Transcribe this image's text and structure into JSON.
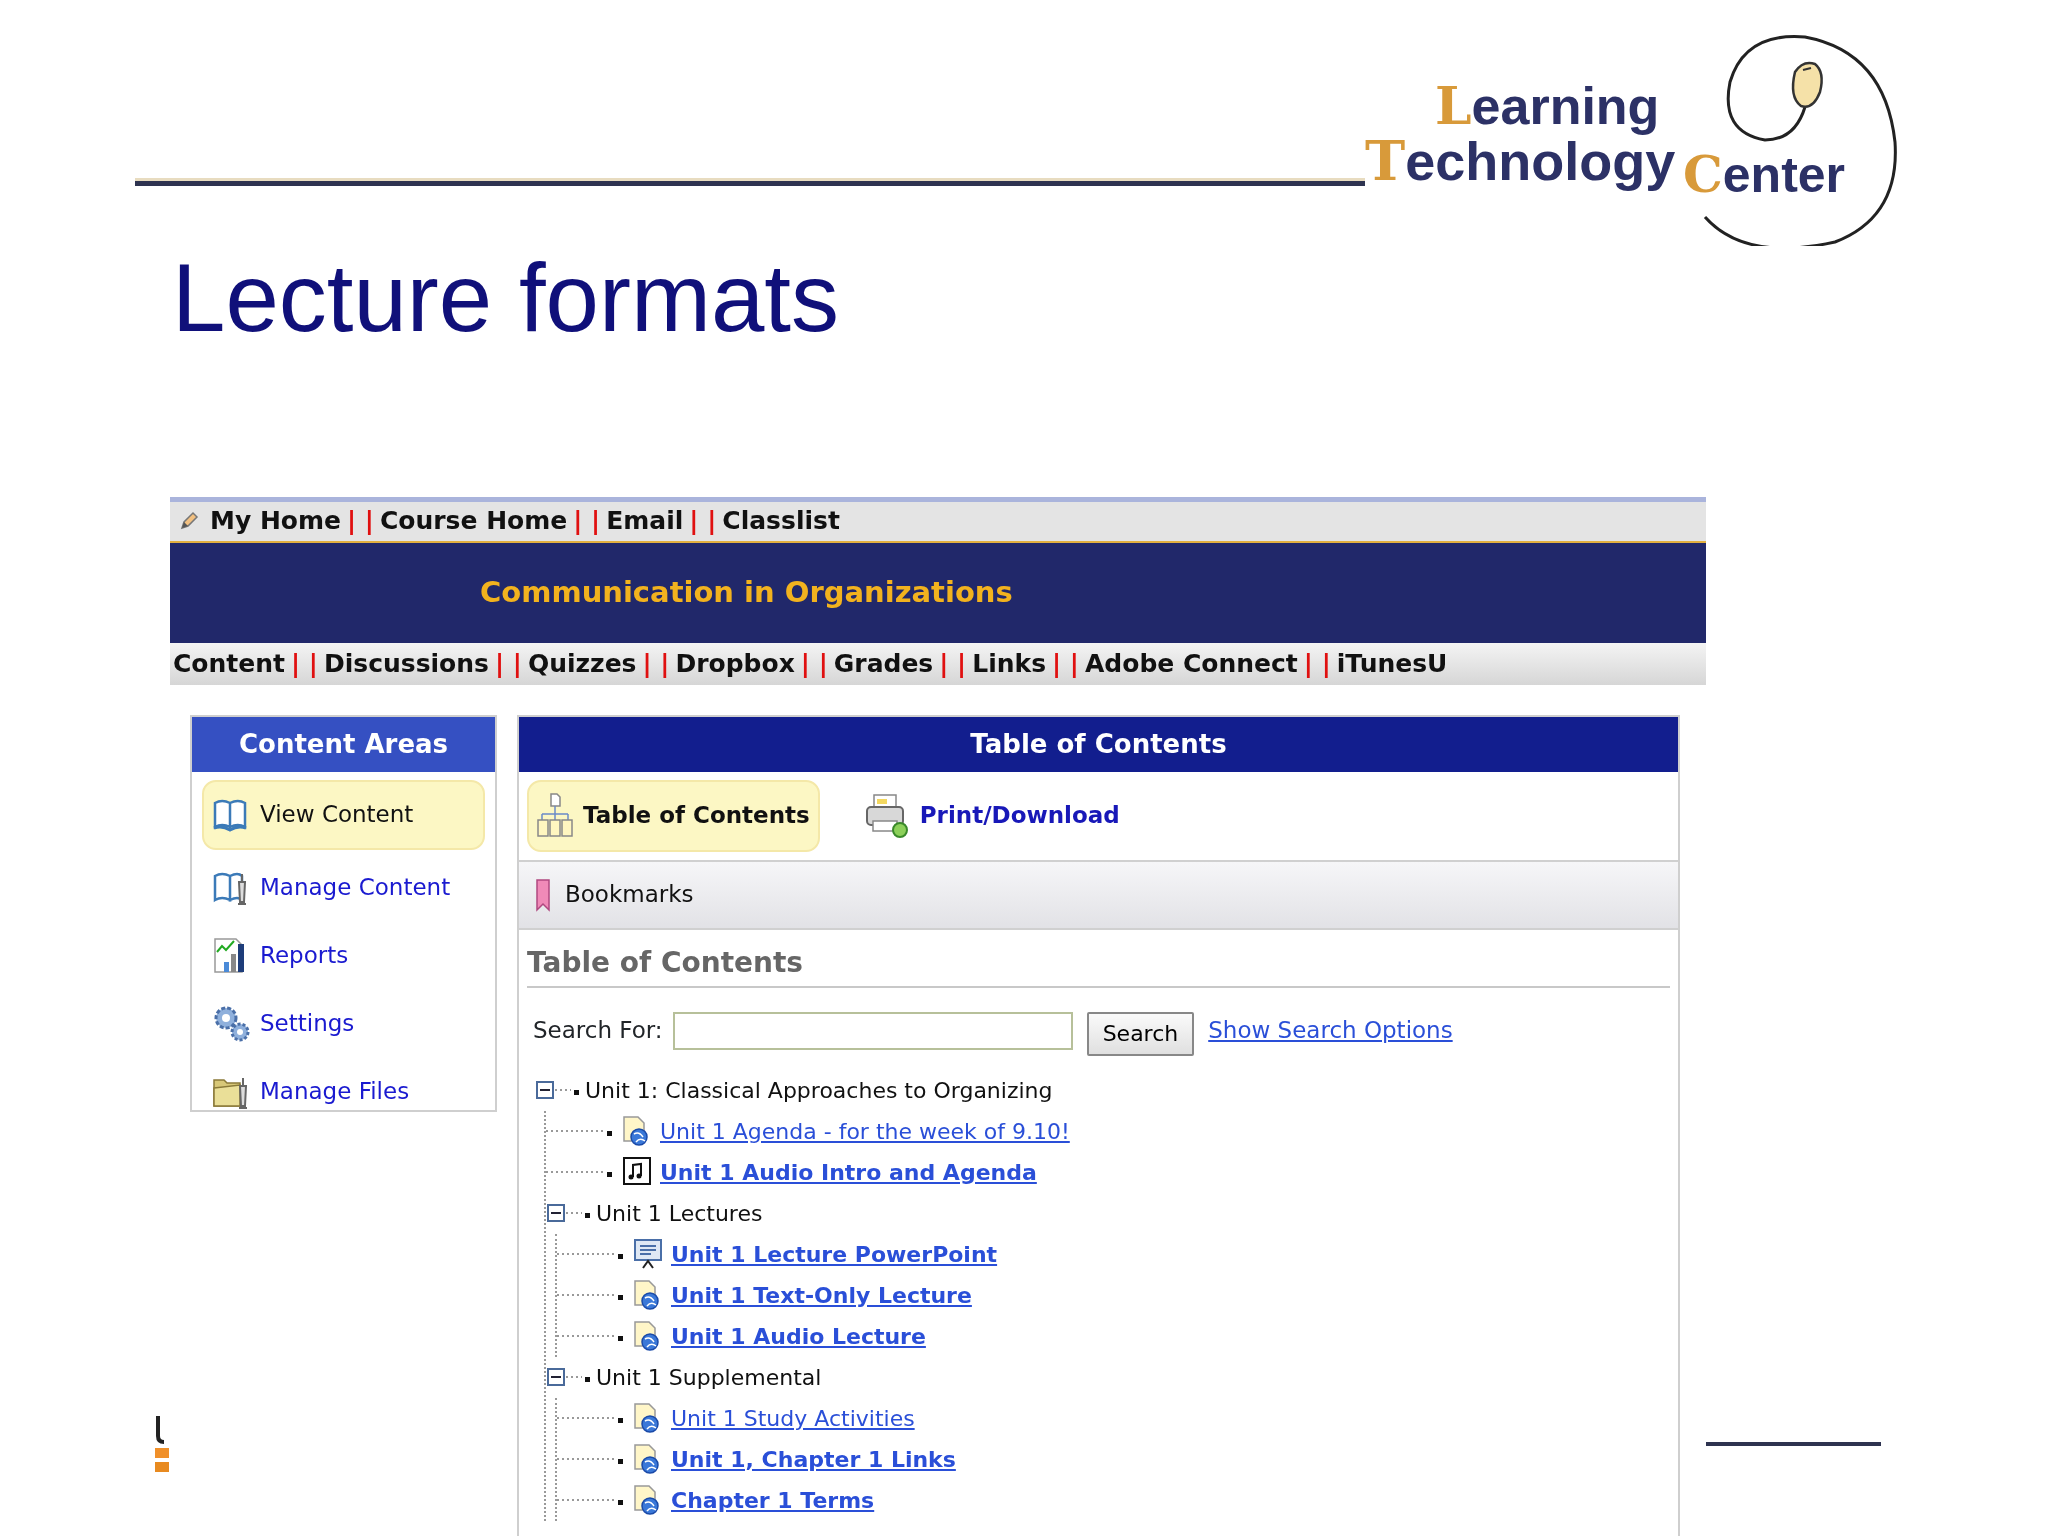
{
  "slide": {
    "title": "Lecture formats",
    "logo": {
      "words": [
        "Learning",
        "Technology",
        "Center"
      ]
    }
  },
  "top_nav": {
    "separator": "| |",
    "items": [
      "My Home",
      "Course Home",
      "Email",
      "Classlist"
    ]
  },
  "banner": {
    "title": "Communication in Organizations"
  },
  "course_nav": {
    "separator": "| |",
    "items": [
      "Content",
      "Discussions",
      "Quizzes",
      "Dropbox",
      "Grades",
      "Links",
      "Adobe Connect",
      "iTunesU"
    ]
  },
  "content_areas": {
    "title": "Content Areas",
    "items": [
      {
        "label": "View Content",
        "selected": true
      },
      {
        "label": "Manage Content",
        "selected": false
      },
      {
        "label": "Reports",
        "selected": false
      },
      {
        "label": "Settings",
        "selected": false
      },
      {
        "label": "Manage Files",
        "selected": false
      }
    ]
  },
  "toc_panel": {
    "title": "Table of Contents",
    "tools": [
      {
        "label": "Table of Contents",
        "kind": "tab",
        "selected": true
      },
      {
        "label": "Print/Download",
        "kind": "print",
        "selected": false
      }
    ],
    "bookmarks": "Bookmarks",
    "heading": "Table of Contents",
    "search": {
      "label": "Search For:",
      "button": "Search",
      "options_link": "Show Search Options"
    },
    "tree": [
      {
        "kind": "folder",
        "label": "Unit 1: Classical Approaches to Organizing",
        "expanded": true,
        "children": [
          {
            "kind": "web",
            "label": "Unit 1 Agenda - for the week of 9.10!",
            "bold": false
          },
          {
            "kind": "audio",
            "label": "Unit 1 Audio Intro and Agenda",
            "bold": true
          },
          {
            "kind": "folder",
            "label": "Unit 1 Lectures",
            "expanded": true,
            "children": [
              {
                "kind": "presentation",
                "label": "Unit 1 Lecture PowerPoint",
                "bold": true
              },
              {
                "kind": "web",
                "label": "Unit 1 Text-Only Lecture",
                "bold": true
              },
              {
                "kind": "web",
                "label": "Unit 1 Audio Lecture",
                "bold": true
              }
            ]
          },
          {
            "kind": "folder",
            "label": "Unit 1 Supplemental",
            "expanded": true,
            "children": [
              {
                "kind": "web",
                "label": "Unit 1 Study Activities",
                "bold": false
              },
              {
                "kind": "web",
                "label": "Unit 1, Chapter 1 Links",
                "bold": true
              },
              {
                "kind": "web",
                "label": "Chapter 1 Terms",
                "bold": true
              }
            ]
          }
        ]
      }
    ]
  }
}
